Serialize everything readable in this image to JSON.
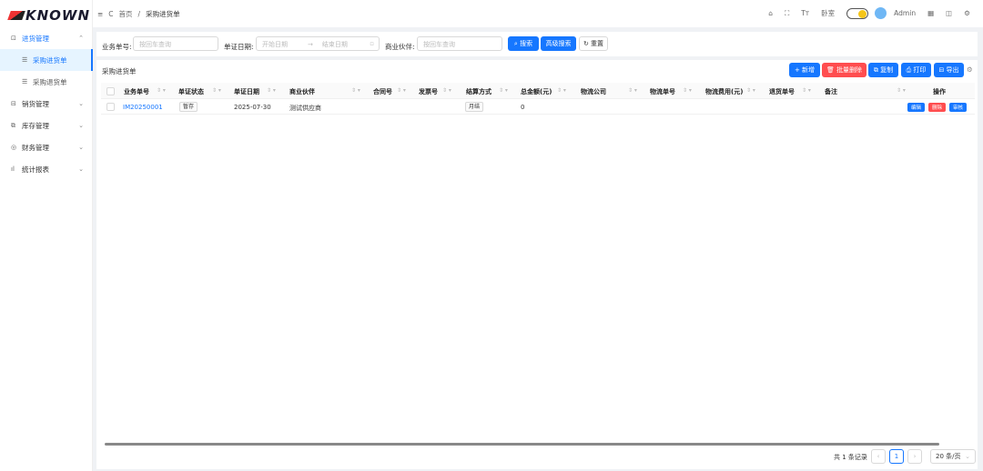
{
  "logo": "KNOWN",
  "sidebar": {
    "items": [
      {
        "label": "进货管理",
        "icon": "inbox-icon",
        "open": true
      },
      {
        "label": "采购进货单",
        "icon": "list-icon",
        "active": true
      },
      {
        "label": "采购退货单",
        "icon": "list-icon"
      },
      {
        "label": "销货管理",
        "icon": "outbox-icon"
      },
      {
        "label": "库存管理",
        "icon": "warehouse-icon"
      },
      {
        "label": "财务管理",
        "icon": "finance-icon"
      },
      {
        "label": "统计报表",
        "icon": "chart-icon"
      }
    ]
  },
  "header": {
    "breadcrumb": [
      "首页",
      "采购进货单"
    ],
    "layout_label": "卧室",
    "user": "Admin"
  },
  "search": {
    "order_label": "业务单号:",
    "order_placeholder": "按回车查询",
    "date_label": "单证日期:",
    "date_start": "开始日期",
    "date_end": "结束日期",
    "partner_label": "商业伙伴:",
    "partner_placeholder": "按回车查询",
    "search_btn": "搜索",
    "advanced_btn": "高级搜索",
    "reset_btn": "重置"
  },
  "table": {
    "title": "采购进货单",
    "toolbar": {
      "add": "新增",
      "batch_delete": "批量删除",
      "copy": "复制",
      "print": "打印",
      "export": "导出"
    },
    "columns": [
      "业务单号",
      "单证状态",
      "单证日期",
      "商业伙伴",
      "合同号",
      "发票号",
      "结算方式",
      "总金额(元)",
      "物流公司",
      "物流单号",
      "物流费用(元)",
      "退货单号",
      "备注",
      "操作"
    ],
    "rows": [
      {
        "order_no": "IM20250001",
        "status": "暂存",
        "date": "2025-07-30",
        "partner": "测试供应商",
        "contract": "",
        "invoice": "",
        "settlement": "月结",
        "total": "0",
        "logistics_company": "",
        "logistics_no": "",
        "logistics_fee": "",
        "return_no": "",
        "remark": "",
        "actions": [
          "编辑",
          "删除",
          "审核"
        ]
      }
    ]
  },
  "pagination": {
    "total_text": "共 1 条记录",
    "current_page": "1",
    "page_size": "20 条/页"
  },
  "colors": {
    "primary": "#1677ff",
    "danger": "#ff4d4f"
  }
}
